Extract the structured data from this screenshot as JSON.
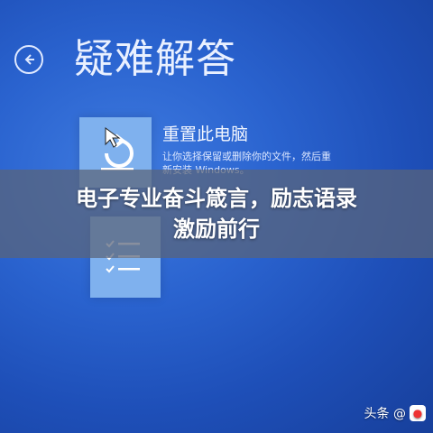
{
  "screen": {
    "title": "疑难解答",
    "reset_option": {
      "title": "重置此电脑",
      "description_line1": "让你选择保留或删除你的文件，然后重",
      "description_line2": "新安装 Windows。"
    }
  },
  "banner": {
    "line1": "电子专业奋斗箴言，励志语录",
    "line2": "激励前行"
  },
  "watermark": {
    "text": "头条 @"
  },
  "colors": {
    "background": "#2a63cf",
    "tile": "#7fb1ee",
    "banner_overlay": "#5a6478"
  },
  "icons": [
    "back-arrow-icon",
    "refresh-icon",
    "checklist-icon",
    "mouse-cursor-icon"
  ]
}
